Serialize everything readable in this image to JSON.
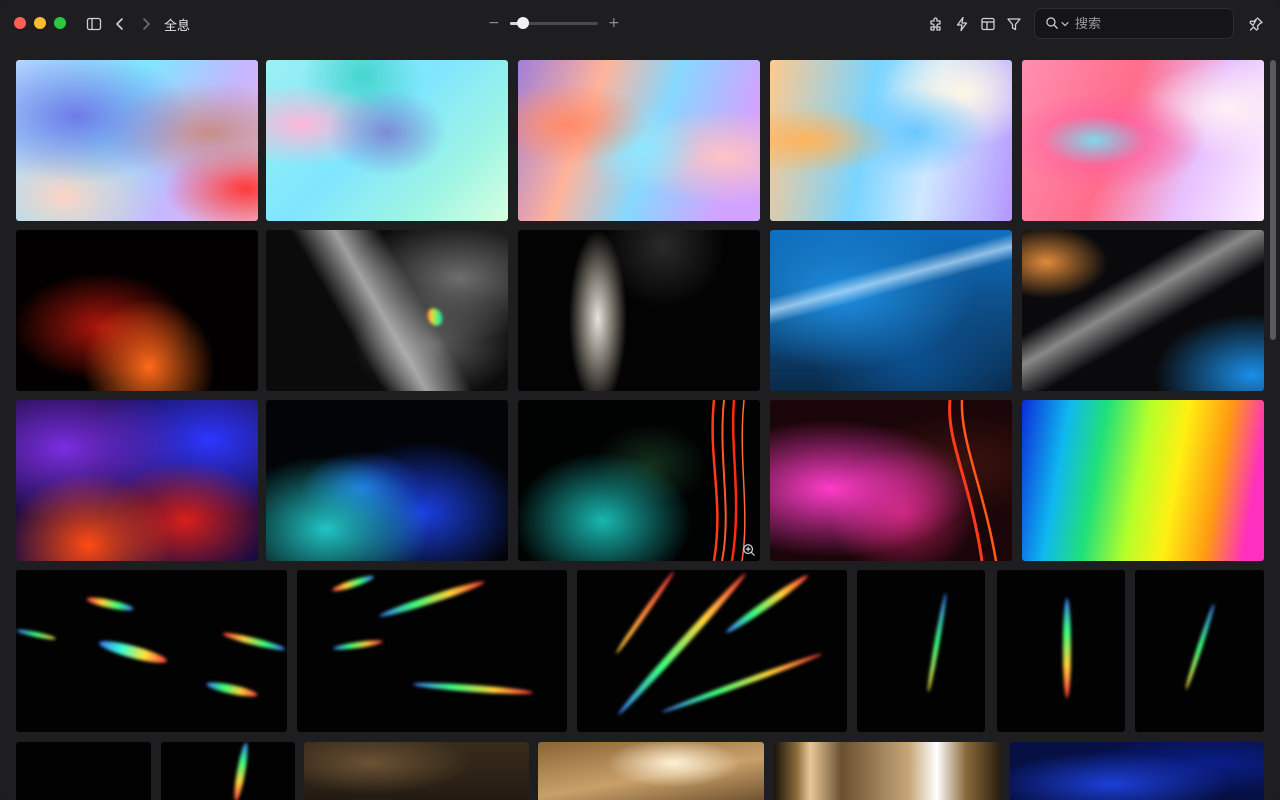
{
  "window": {
    "title": "全息",
    "traffic_lights": {
      "close": "#ff5f57",
      "minimize": "#febc2e",
      "maximize": "#28c840"
    }
  },
  "toolbar": {
    "zoom_minus": "−",
    "zoom_plus": "+",
    "zoom_level": 0.15,
    "search": {
      "placeholder": "搜索",
      "value": ""
    },
    "icons": [
      "sidebar-icon",
      "back-icon",
      "forward-icon",
      "extensions-icon",
      "action-icon",
      "layout-icon",
      "filter-icon",
      "search-icon",
      "pin-icon"
    ]
  },
  "grid": {
    "items": [
      "hologram-1",
      "hologram-2",
      "hologram-3",
      "hologram-4",
      "hologram-5",
      "red-flare",
      "grey-prism",
      "white-beam",
      "blue-light",
      "grey-blue-flare",
      "purple-red-gradient",
      "blue-teal-gradient",
      "teal-light-trails",
      "magenta-trails",
      "rainbow-spectrum",
      "prism-streaks-1",
      "prism-streaks-2",
      "prism-streaks-3",
      "prism-streak-4",
      "prism-streak-5",
      "prism-streak-6",
      "dark-1",
      "rainbow-streak",
      "gold-texture-1",
      "gold-texture-2",
      "gold-rainbow",
      "blue-texture"
    ]
  },
  "colors": {
    "background": "#1e1e20",
    "search_bg": "#151517",
    "accent_text": "#e5e5e7"
  }
}
